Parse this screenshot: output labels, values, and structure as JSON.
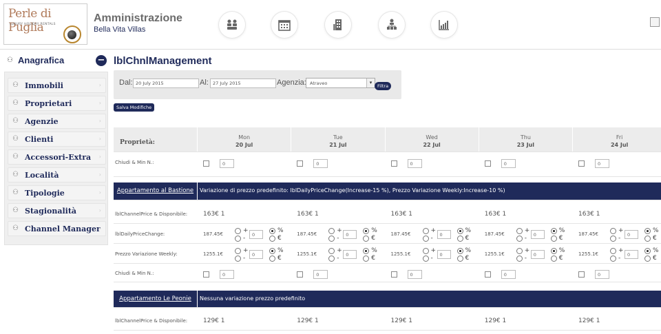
{
  "brand": {
    "logo_text": "Perle di Puglia",
    "logo_sub": "LUXURY HOLIDAY RENTALS"
  },
  "app": {
    "title": "Amministrazione",
    "subtitle": "Bella Vita Villas"
  },
  "top_icons": [
    "users-icon",
    "calendar-icon",
    "building-icon",
    "org-chart-icon",
    "bar-chart-icon"
  ],
  "sidebar": {
    "heading": "Anagrafica",
    "items": [
      {
        "label": "Immobili"
      },
      {
        "label": "Proprietari"
      },
      {
        "label": "Agenzie"
      },
      {
        "label": "Clienti"
      },
      {
        "label": "Accessori-Extra"
      },
      {
        "label": "Località"
      },
      {
        "label": "Tipologie"
      },
      {
        "label": "Stagionalità"
      },
      {
        "label": "Channel Manager"
      }
    ]
  },
  "page": {
    "title": "lblChnlManagement"
  },
  "filter": {
    "dal_label": "Dal:",
    "dal_value": "20 July 2015",
    "al_label": "Al:",
    "al_value": "27 July 2015",
    "agenzia_label": "Agenzia:",
    "agenzia_value": "Atraveo",
    "filter_button": "Filtra"
  },
  "save_button": "Salva Modifiche",
  "grid": {
    "property_header": "Proprietà:",
    "days": [
      {
        "dow": "Mon",
        "date": "20 Jul"
      },
      {
        "dow": "Tue",
        "date": "21 Jul"
      },
      {
        "dow": "Wed",
        "date": "22 Jul"
      },
      {
        "dow": "Thu",
        "date": "23 Jul"
      },
      {
        "dow": "Fri",
        "date": "24 Jul"
      }
    ],
    "close_min_label": "Chiudi & Min N.:",
    "close_min_value": "0",
    "properties": [
      {
        "name": "Appartamento al Bastione",
        "description": "Variazione di prezzo predefinito: lblDailyPriceChange(Increase-15 %), Prezzo Variazione Weekly:Increase-10 %)",
        "price_label": "lblChannelPrice & Disponibile:",
        "price_value": "163€ 1",
        "daily_label": "lblDailyPriceChange:",
        "daily_value": "187.45€",
        "weekly_label": "Prezzo Variazione Weekly:",
        "weekly_value": "1255.1€",
        "step_value": "0",
        "close_min_label": "Chiudi & Min N.:",
        "close_min_value": "0"
      },
      {
        "name": "Appartamento Le Peonie",
        "description": "Nessuna variazione prezzo predefinito",
        "price_label": "lblChannelPrice & Disponibile:",
        "price_value": "129€ 1"
      }
    ],
    "sym_plus": "+",
    "sym_minus": "-",
    "sym_pct": "%",
    "sym_eur": "€"
  }
}
